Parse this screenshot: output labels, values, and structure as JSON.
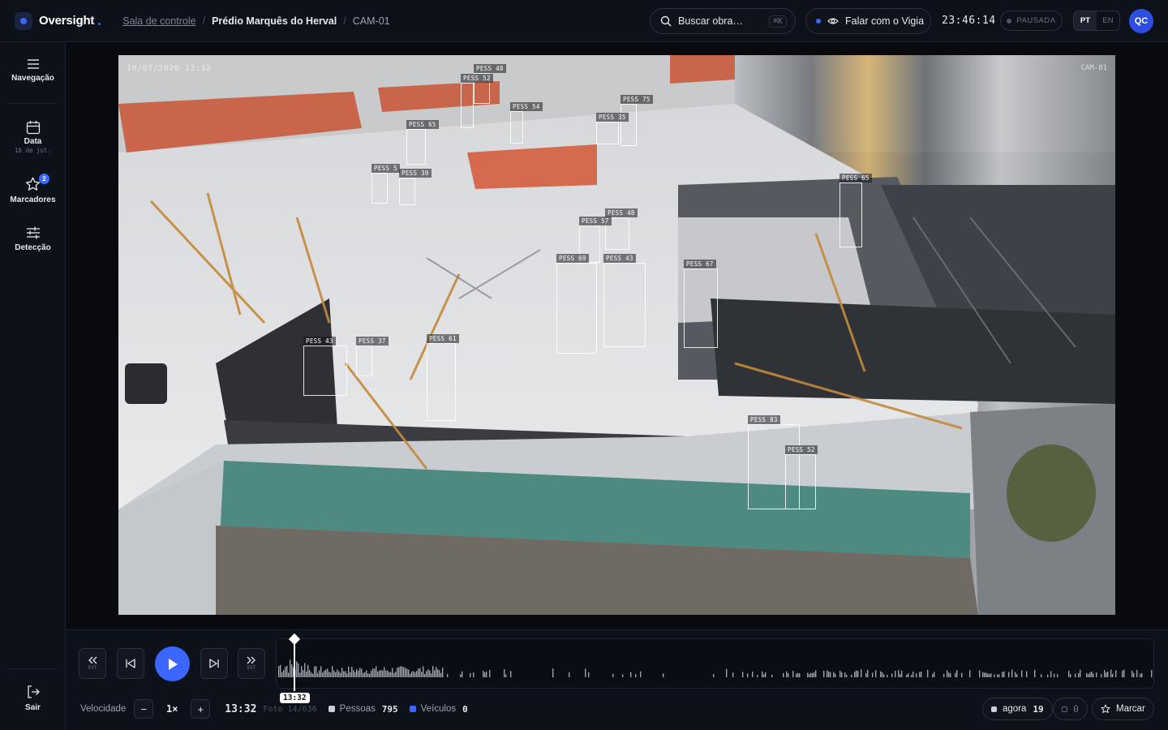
{
  "app": {
    "name": "Oversight"
  },
  "breadcrumb": {
    "root": "Sala de controle",
    "building": "Prédio Marquês do Herval",
    "camera": "CAM-01"
  },
  "search": {
    "placeholder": "Buscar obra…",
    "shortcut": "⌘K"
  },
  "talk": {
    "label": "Falar com o Vigia"
  },
  "clock": "23:46:14",
  "status": {
    "label": "PAUSADA"
  },
  "language": {
    "active": "PT",
    "other": "EN"
  },
  "user": {
    "initials": "QC"
  },
  "sidebar": {
    "nav_label": "Navegação",
    "date_label": "Data",
    "date_value": "10 de jul.",
    "bookmarks_label": "Marcadores",
    "bookmarks_count": "2",
    "detection_label": "Detecção",
    "exit_label": "Sair"
  },
  "video": {
    "timestamp": "10/07/2026  13:32",
    "camera_tag": "CAM-01",
    "detections": [
      "PESS 48",
      "PESS 52",
      "PESS 54",
      "PESS 75",
      "PESS 35",
      "PESS 65",
      "PESS 5",
      "PESS 39",
      "PESS 65",
      "PESS 48",
      "PESS 57",
      "PESS 69",
      "PESS 43",
      "PESS 67",
      "PESS 43",
      "PESS 37",
      "PESS 61",
      "PESS 83",
      "PESS 52"
    ]
  },
  "controls": {
    "rewind_tag": "EVT",
    "forward_tag": "EVT",
    "speed_label": "Velocidade",
    "speed_value": "1×",
    "minus": "−",
    "plus": "+",
    "time": "13:32",
    "frame": "Foto 14/636",
    "playhead_time": "13:32",
    "people_label": "Pessoas",
    "people_count": "795",
    "vehicles_label": "Veículos",
    "vehicles_count": "0",
    "now_label": "agora",
    "now_count": "19",
    "marker_count": "0",
    "mark_label": "Marcar",
    "people_color": "#c9ced8",
    "vehicles_color": "#3b66ff"
  }
}
